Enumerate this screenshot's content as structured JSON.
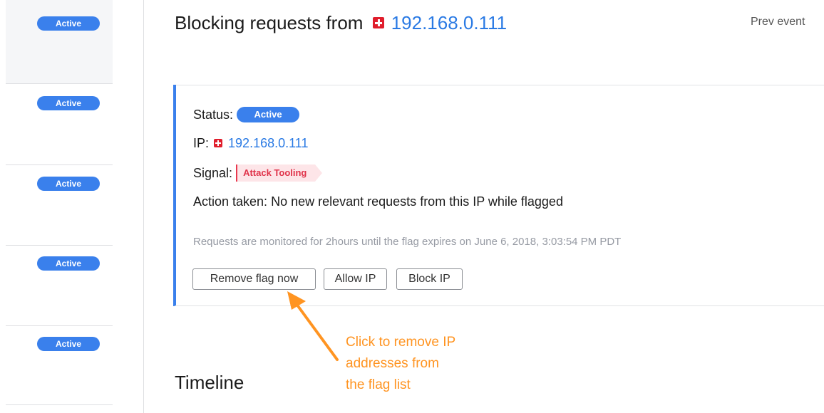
{
  "sidebar": {
    "items": [
      {
        "status": "Active"
      },
      {
        "status": "Active"
      },
      {
        "status": "Active"
      },
      {
        "status": "Active"
      },
      {
        "status": "Active"
      }
    ]
  },
  "header": {
    "title_prefix": "Blocking requests from",
    "ip": "192.168.0.111",
    "flag_icon": "swiss-flag-icon",
    "prev_event": "Prev event"
  },
  "event": {
    "status_label": "Status:",
    "status_value": "Active",
    "ip_label": "IP:",
    "ip_value": "192.168.0.111",
    "signal_label": "Signal:",
    "signal_value": "Attack Tooling",
    "action_label": "Action taken:",
    "action_value": "No new relevant requests from this IP while flagged",
    "monitor_note": "Requests are monitored for 2hours until the flag expires on June 6, 2018, 3:03:54 PM PDT",
    "buttons": {
      "remove_flag": "Remove flag now",
      "allow_ip": "Allow IP",
      "block_ip": "Block IP"
    }
  },
  "timeline": {
    "title": "Timeline"
  },
  "annotation": {
    "lines": [
      "Click to remove IP",
      "addresses from",
      "the flag list"
    ]
  },
  "colors": {
    "accent": "#3a80ec",
    "link": "#2a7ae4",
    "signal": "#e0334a",
    "annotation": "#ff9421"
  }
}
